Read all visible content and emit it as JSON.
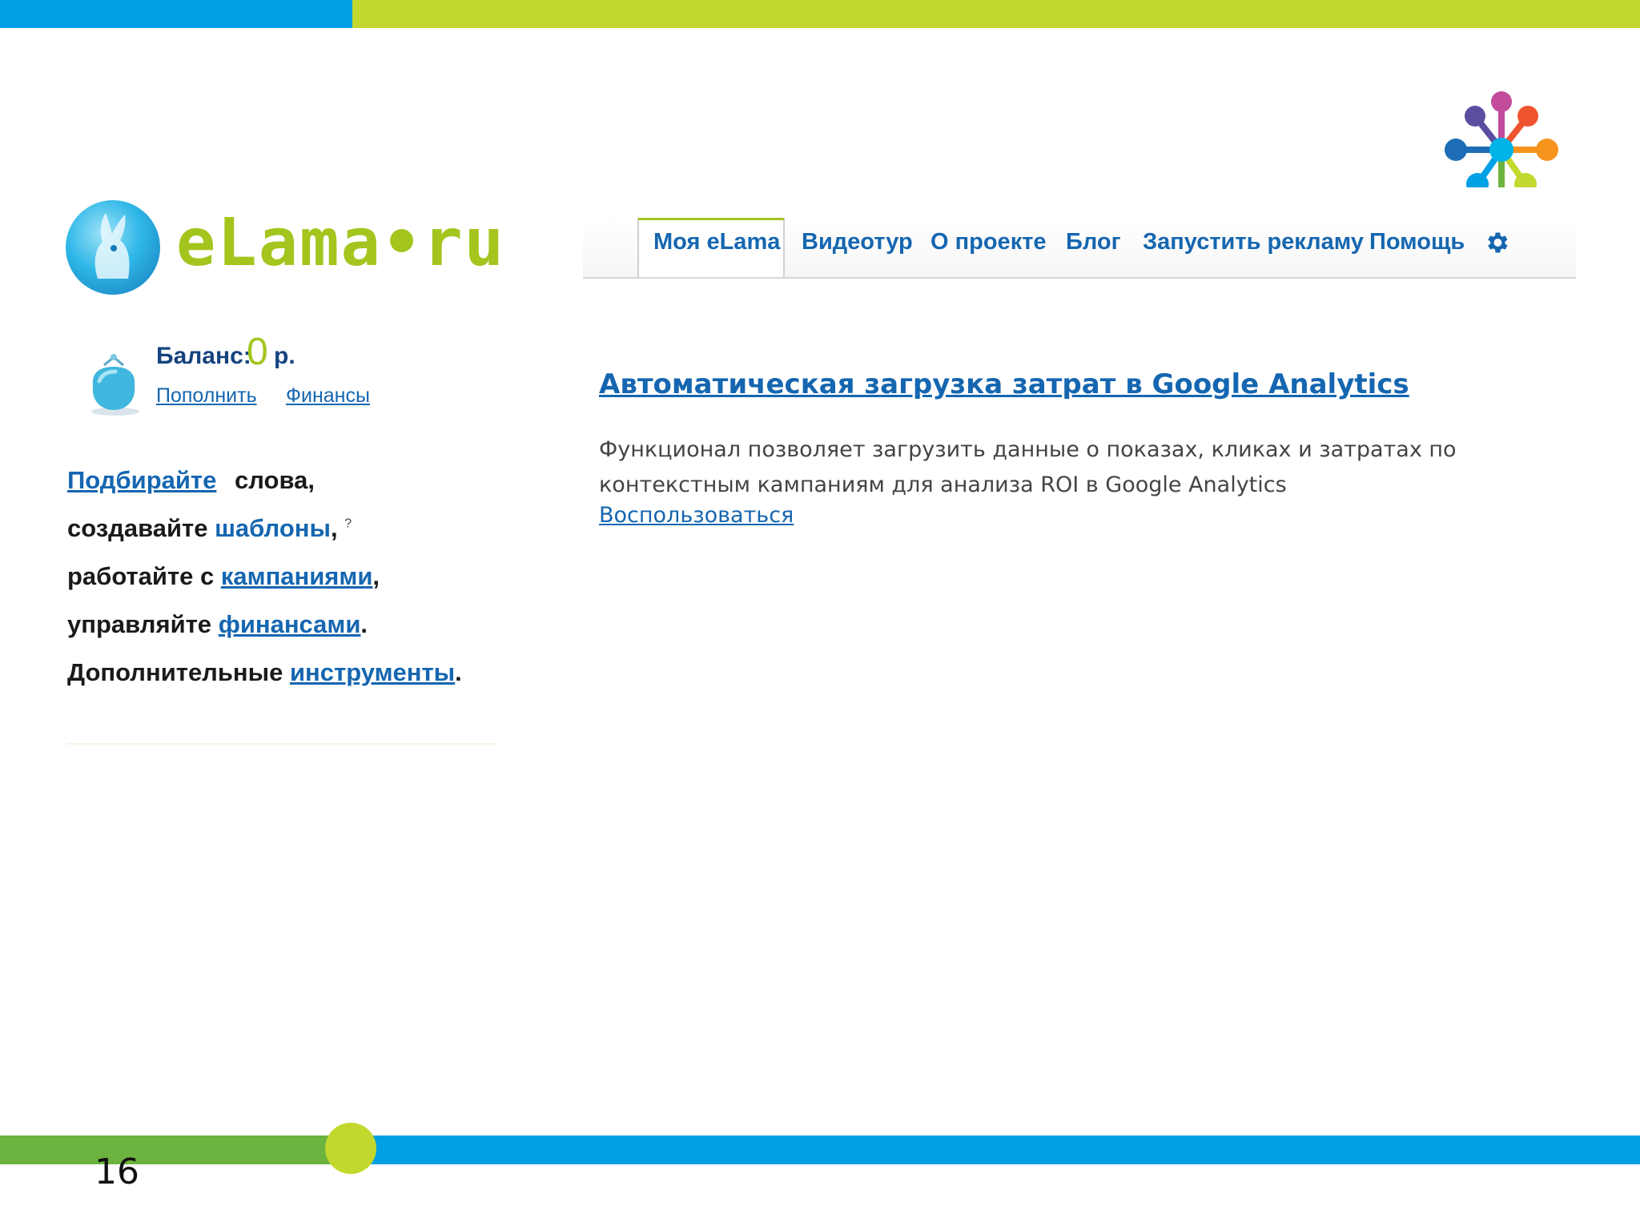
{
  "colors": {
    "blue": "#00a0e4",
    "lime": "#c2d82e",
    "green": "#6cb33f",
    "link": "#1566b0"
  },
  "logo": {
    "text": "eLama•ru"
  },
  "nav": {
    "tabs": [
      {
        "label": "Моя eLama",
        "active": true
      },
      {
        "label": "Видеотур"
      },
      {
        "label": "О проекте"
      },
      {
        "label": "Блог"
      },
      {
        "label": "Запустить рекламу"
      },
      {
        "label": "Помощь"
      }
    ],
    "settings_icon": "gear-icon"
  },
  "balance": {
    "label": "Баланс:",
    "value": "0",
    "currency": "р.",
    "links": [
      "Пополнить",
      "Финансы"
    ]
  },
  "sidebar_lines": {
    "l1_link": "Подбирайте",
    "l1_text": "слова,",
    "l2_text": "создавайте",
    "l2_link": "шаблоны",
    "l2_suffix": ",",
    "l2_help": "?",
    "l3_text": "работайте с",
    "l3_link": "кампаниями",
    "l3_suffix": ",",
    "l4_text": "управляйте",
    "l4_link": "финансами",
    "l4_suffix": ".",
    "l5_text": "Дополнительные",
    "l5_link": "инструменты",
    "l5_suffix": "."
  },
  "article": {
    "title": "Автоматическая загрузка затрат в Google Analytics",
    "text": "Функционал позволяет загрузить данные о показах, кликах и затратах по контекстным кампаниям для анализа ROI в Google Analytics",
    "action": "Воспользоваться"
  },
  "footer": {
    "page_number": "16"
  }
}
